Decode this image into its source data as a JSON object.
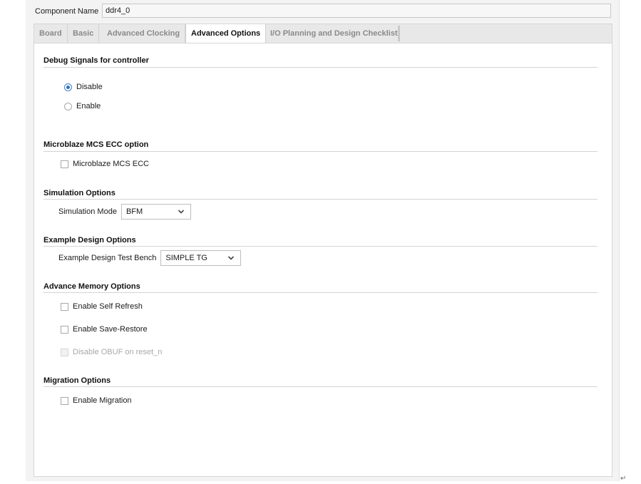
{
  "component": {
    "label": "Component Name",
    "value": "ddr4_0"
  },
  "tabs": [
    {
      "label": "Board"
    },
    {
      "label": "Basic"
    },
    {
      "label": "Advanced Clocking"
    },
    {
      "label": "Advanced Options"
    },
    {
      "label": "I/O Planning and Design Checklist"
    }
  ],
  "sections": {
    "debug": {
      "title": "Debug Signals for controller",
      "options": [
        "Disable",
        "Enable"
      ],
      "selected": "Disable"
    },
    "mcs": {
      "title": "Microblaze MCS ECC option",
      "checkbox": "Microblaze MCS ECC"
    },
    "simulation": {
      "title": "Simulation Options",
      "field_label": "Simulation Mode",
      "value": "BFM"
    },
    "example": {
      "title": "Example Design Options",
      "field_label": "Example Design Test Bench",
      "value": "SIMPLE TG"
    },
    "memory": {
      "title": "Advance Memory Options",
      "checkboxes": [
        "Enable Self Refresh",
        "Enable Save-Restore",
        "Disable OBUF on reset_n"
      ]
    },
    "migration": {
      "title": "Migration Options",
      "checkbox": "Enable Migration"
    }
  },
  "colors": {
    "accent": "#2f6fb8",
    "panel_bg": "#ffffff",
    "window_bg": "#f3f3f3"
  },
  "icons": {
    "dropdown": "chevron-down-icon",
    "return": "return-mark-icon"
  },
  "return_mark": "↵"
}
